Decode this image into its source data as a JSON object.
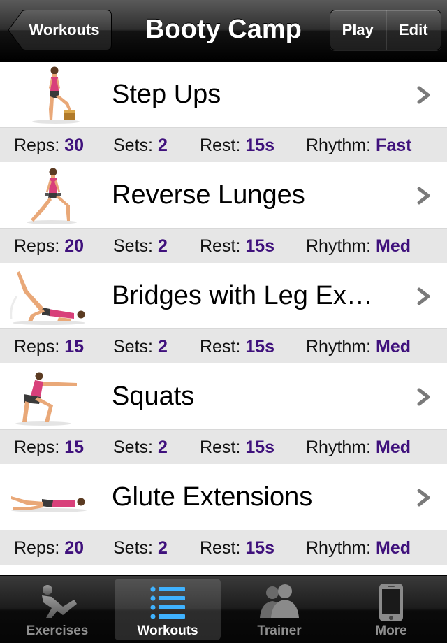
{
  "nav": {
    "back_label": "Workouts",
    "title": "Booty Camp",
    "play_label": "Play",
    "edit_label": "Edit"
  },
  "stat_labels": {
    "reps": "Reps:",
    "sets": "Sets:",
    "rest": "Rest:",
    "rhythm": "Rhythm:"
  },
  "exercises": [
    {
      "name": "Step Ups",
      "reps": "30",
      "sets": "2",
      "rest": "15s",
      "rhythm": "Fast",
      "icon": "step-ups-figure-icon"
    },
    {
      "name": "Reverse Lunges",
      "reps": "20",
      "sets": "2",
      "rest": "15s",
      "rhythm": "Med",
      "icon": "reverse-lunges-figure-icon"
    },
    {
      "name": "Bridges with Leg Ex…",
      "reps": "15",
      "sets": "2",
      "rest": "15s",
      "rhythm": "Med",
      "icon": "bridges-figure-icon"
    },
    {
      "name": "Squats",
      "reps": "15",
      "sets": "2",
      "rest": "15s",
      "rhythm": "Med",
      "icon": "squats-figure-icon"
    },
    {
      "name": "Glute Extensions",
      "reps": "20",
      "sets": "2",
      "rest": "15s",
      "rhythm": "Med",
      "icon": "glute-extensions-figure-icon"
    }
  ],
  "tabs": [
    {
      "label": "Exercises",
      "icon": "exercises-icon",
      "active": false
    },
    {
      "label": "Workouts",
      "icon": "list-icon",
      "active": true
    },
    {
      "label": "Trainer",
      "icon": "trainer-icon",
      "active": false
    },
    {
      "label": "More",
      "icon": "phone-icon",
      "active": false
    }
  ],
  "colors": {
    "stat_value": "#3f117c",
    "stat_row_bg": "#e6e6e6",
    "skin": "#e9a878",
    "top": "#d8407a",
    "shorts": "#3a3a3a"
  }
}
